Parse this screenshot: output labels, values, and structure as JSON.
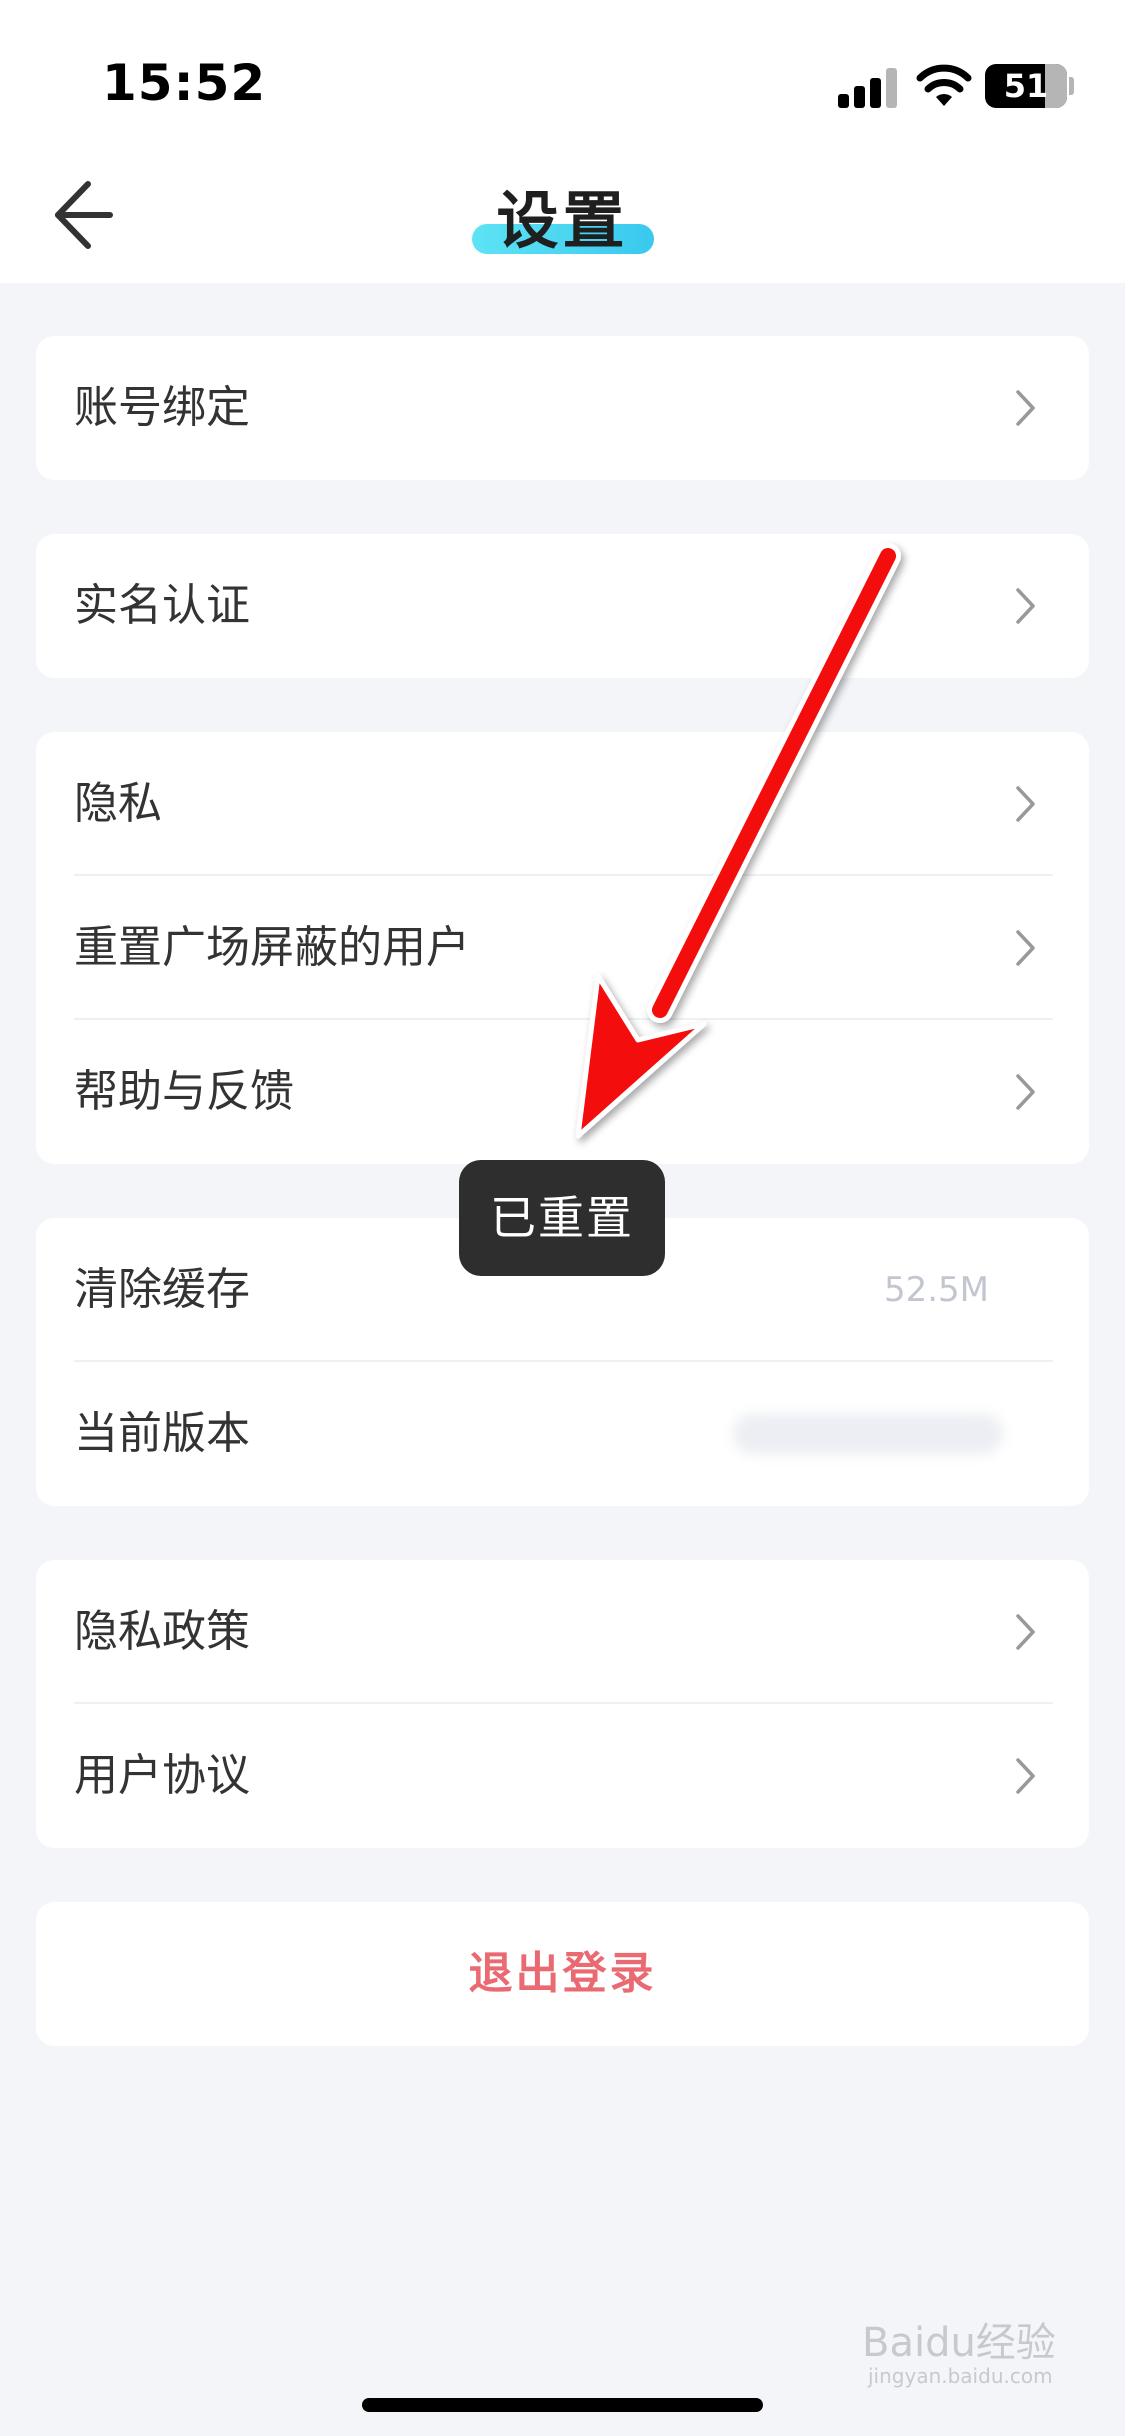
{
  "status_bar": {
    "time": "15:52",
    "battery_level": "51",
    "icons": [
      "signal-icon",
      "wifi-icon",
      "battery-icon"
    ]
  },
  "nav": {
    "title": "设置",
    "back_icon": "back-arrow-icon",
    "title_accent_color": "#3fcdee"
  },
  "groups": [
    {
      "rows": [
        {
          "label": "账号绑定",
          "icon": "chevron-right-icon"
        }
      ]
    },
    {
      "rows": [
        {
          "label": "实名认证",
          "icon": "chevron-right-icon"
        }
      ]
    },
    {
      "rows": [
        {
          "label": "隐私",
          "icon": "chevron-right-icon"
        },
        {
          "label": "重置广场屏蔽的用户",
          "icon": "chevron-right-icon"
        },
        {
          "label": "帮助与反馈",
          "icon": "chevron-right-icon"
        }
      ]
    },
    {
      "rows": [
        {
          "label": "清除缓存",
          "value": "52.5M"
        },
        {
          "label": "当前版本"
        }
      ]
    },
    {
      "rows": [
        {
          "label": "隐私政策",
          "icon": "chevron-right-icon"
        },
        {
          "label": "用户协议",
          "icon": "chevron-right-icon"
        }
      ]
    }
  ],
  "logout": {
    "label": "退出登录",
    "color": "#ea6a72"
  },
  "toast": {
    "text": "已重置"
  },
  "annotation": {
    "arrow_color": "#ff0000"
  },
  "watermark": {
    "text": "Baidu经验",
    "url": "jingyan.baidu.com"
  }
}
